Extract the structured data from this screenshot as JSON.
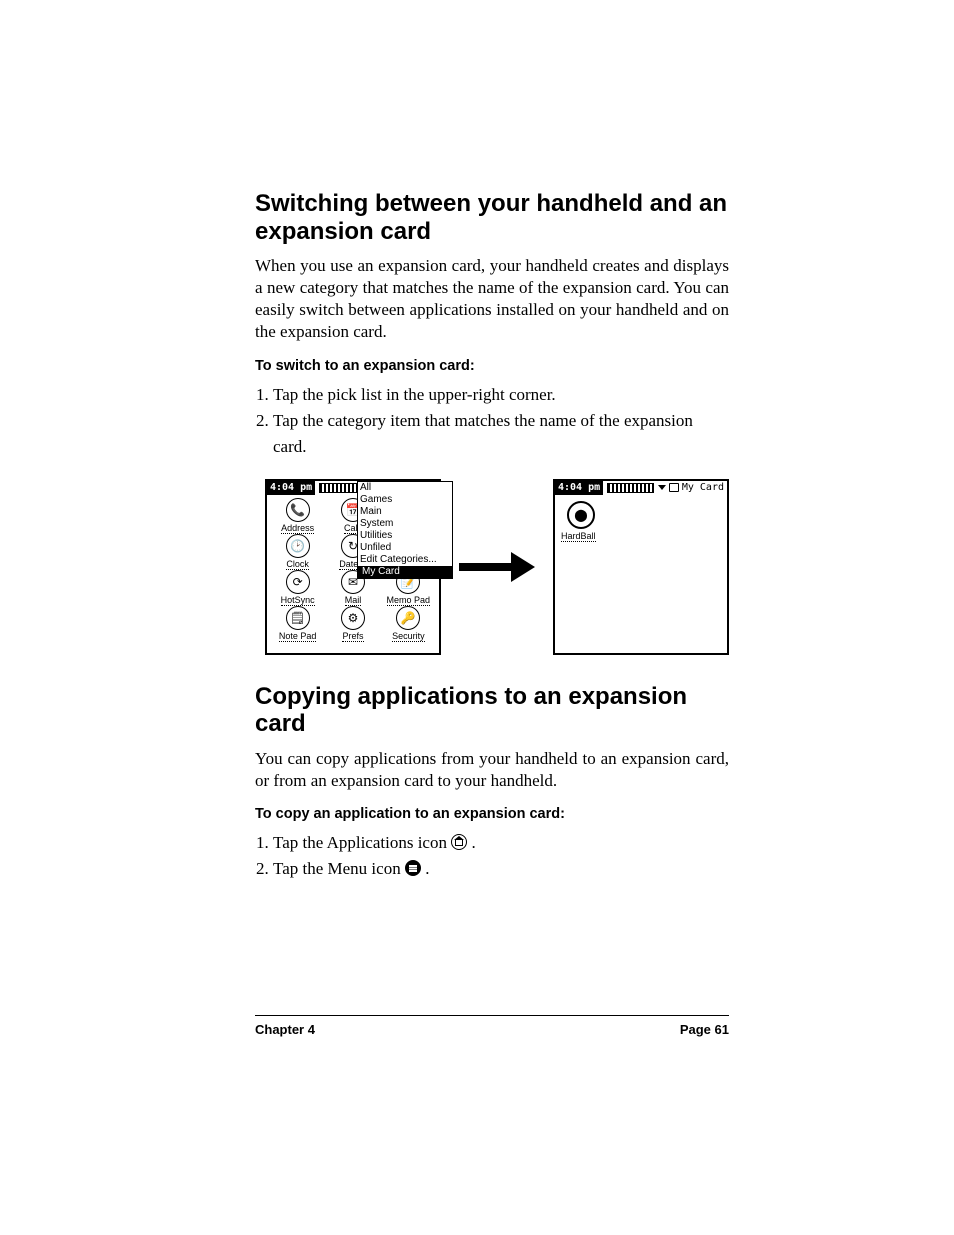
{
  "section1": {
    "heading": "Switching between your handheld and an expansion card",
    "intro": "When you use an expansion card, your handheld creates and displays a new category that matches the name of the expansion card. You can easily switch between applications installed on your handheld and on the expansion card.",
    "subheading": "To switch to an expansion card:",
    "steps": [
      "Tap the pick list in the upper-right corner.",
      "Tap the category item that matches the name of the expansion card."
    ]
  },
  "figure": {
    "left": {
      "time": "4:04 pm",
      "apps": [
        {
          "icon": "📞",
          "label": "Address"
        },
        {
          "icon": "📅",
          "label": "Calc"
        },
        {
          "icon": "",
          "label": ""
        },
        {
          "icon": "🕑",
          "label": "Clock"
        },
        {
          "icon": "↻",
          "label": "Date B"
        },
        {
          "icon": "",
          "label": ""
        },
        {
          "icon": "⟳",
          "label": "HotSync"
        },
        {
          "icon": "✉",
          "label": "Mail"
        },
        {
          "icon": "📝",
          "label": "Memo Pad"
        },
        {
          "icon": "🗒",
          "label": "Note Pad"
        },
        {
          "icon": "⚙",
          "label": "Prefs"
        },
        {
          "icon": "🔑",
          "label": "Security"
        }
      ],
      "dropdown": [
        "All",
        "Games",
        "Main",
        "System",
        "Utilities",
        "Unfiled",
        "Edit Categories..."
      ],
      "dropdown_selected": "My Card"
    },
    "right": {
      "time": "4:04 pm",
      "category": "My Card",
      "app": {
        "icon": "⬤",
        "label": "HardBall"
      }
    }
  },
  "section2": {
    "heading": "Copying applications to an expansion card",
    "intro": "You can copy applications from your handheld to an expansion card, or from an expansion card to your handheld.",
    "subheading": "To copy an application to an expansion card:",
    "steps_pre": [
      "Tap the Applications icon ",
      "Tap the Menu icon "
    ],
    "step_suffix": "."
  },
  "footer": {
    "chapter": "Chapter 4",
    "page": "Page 61"
  }
}
